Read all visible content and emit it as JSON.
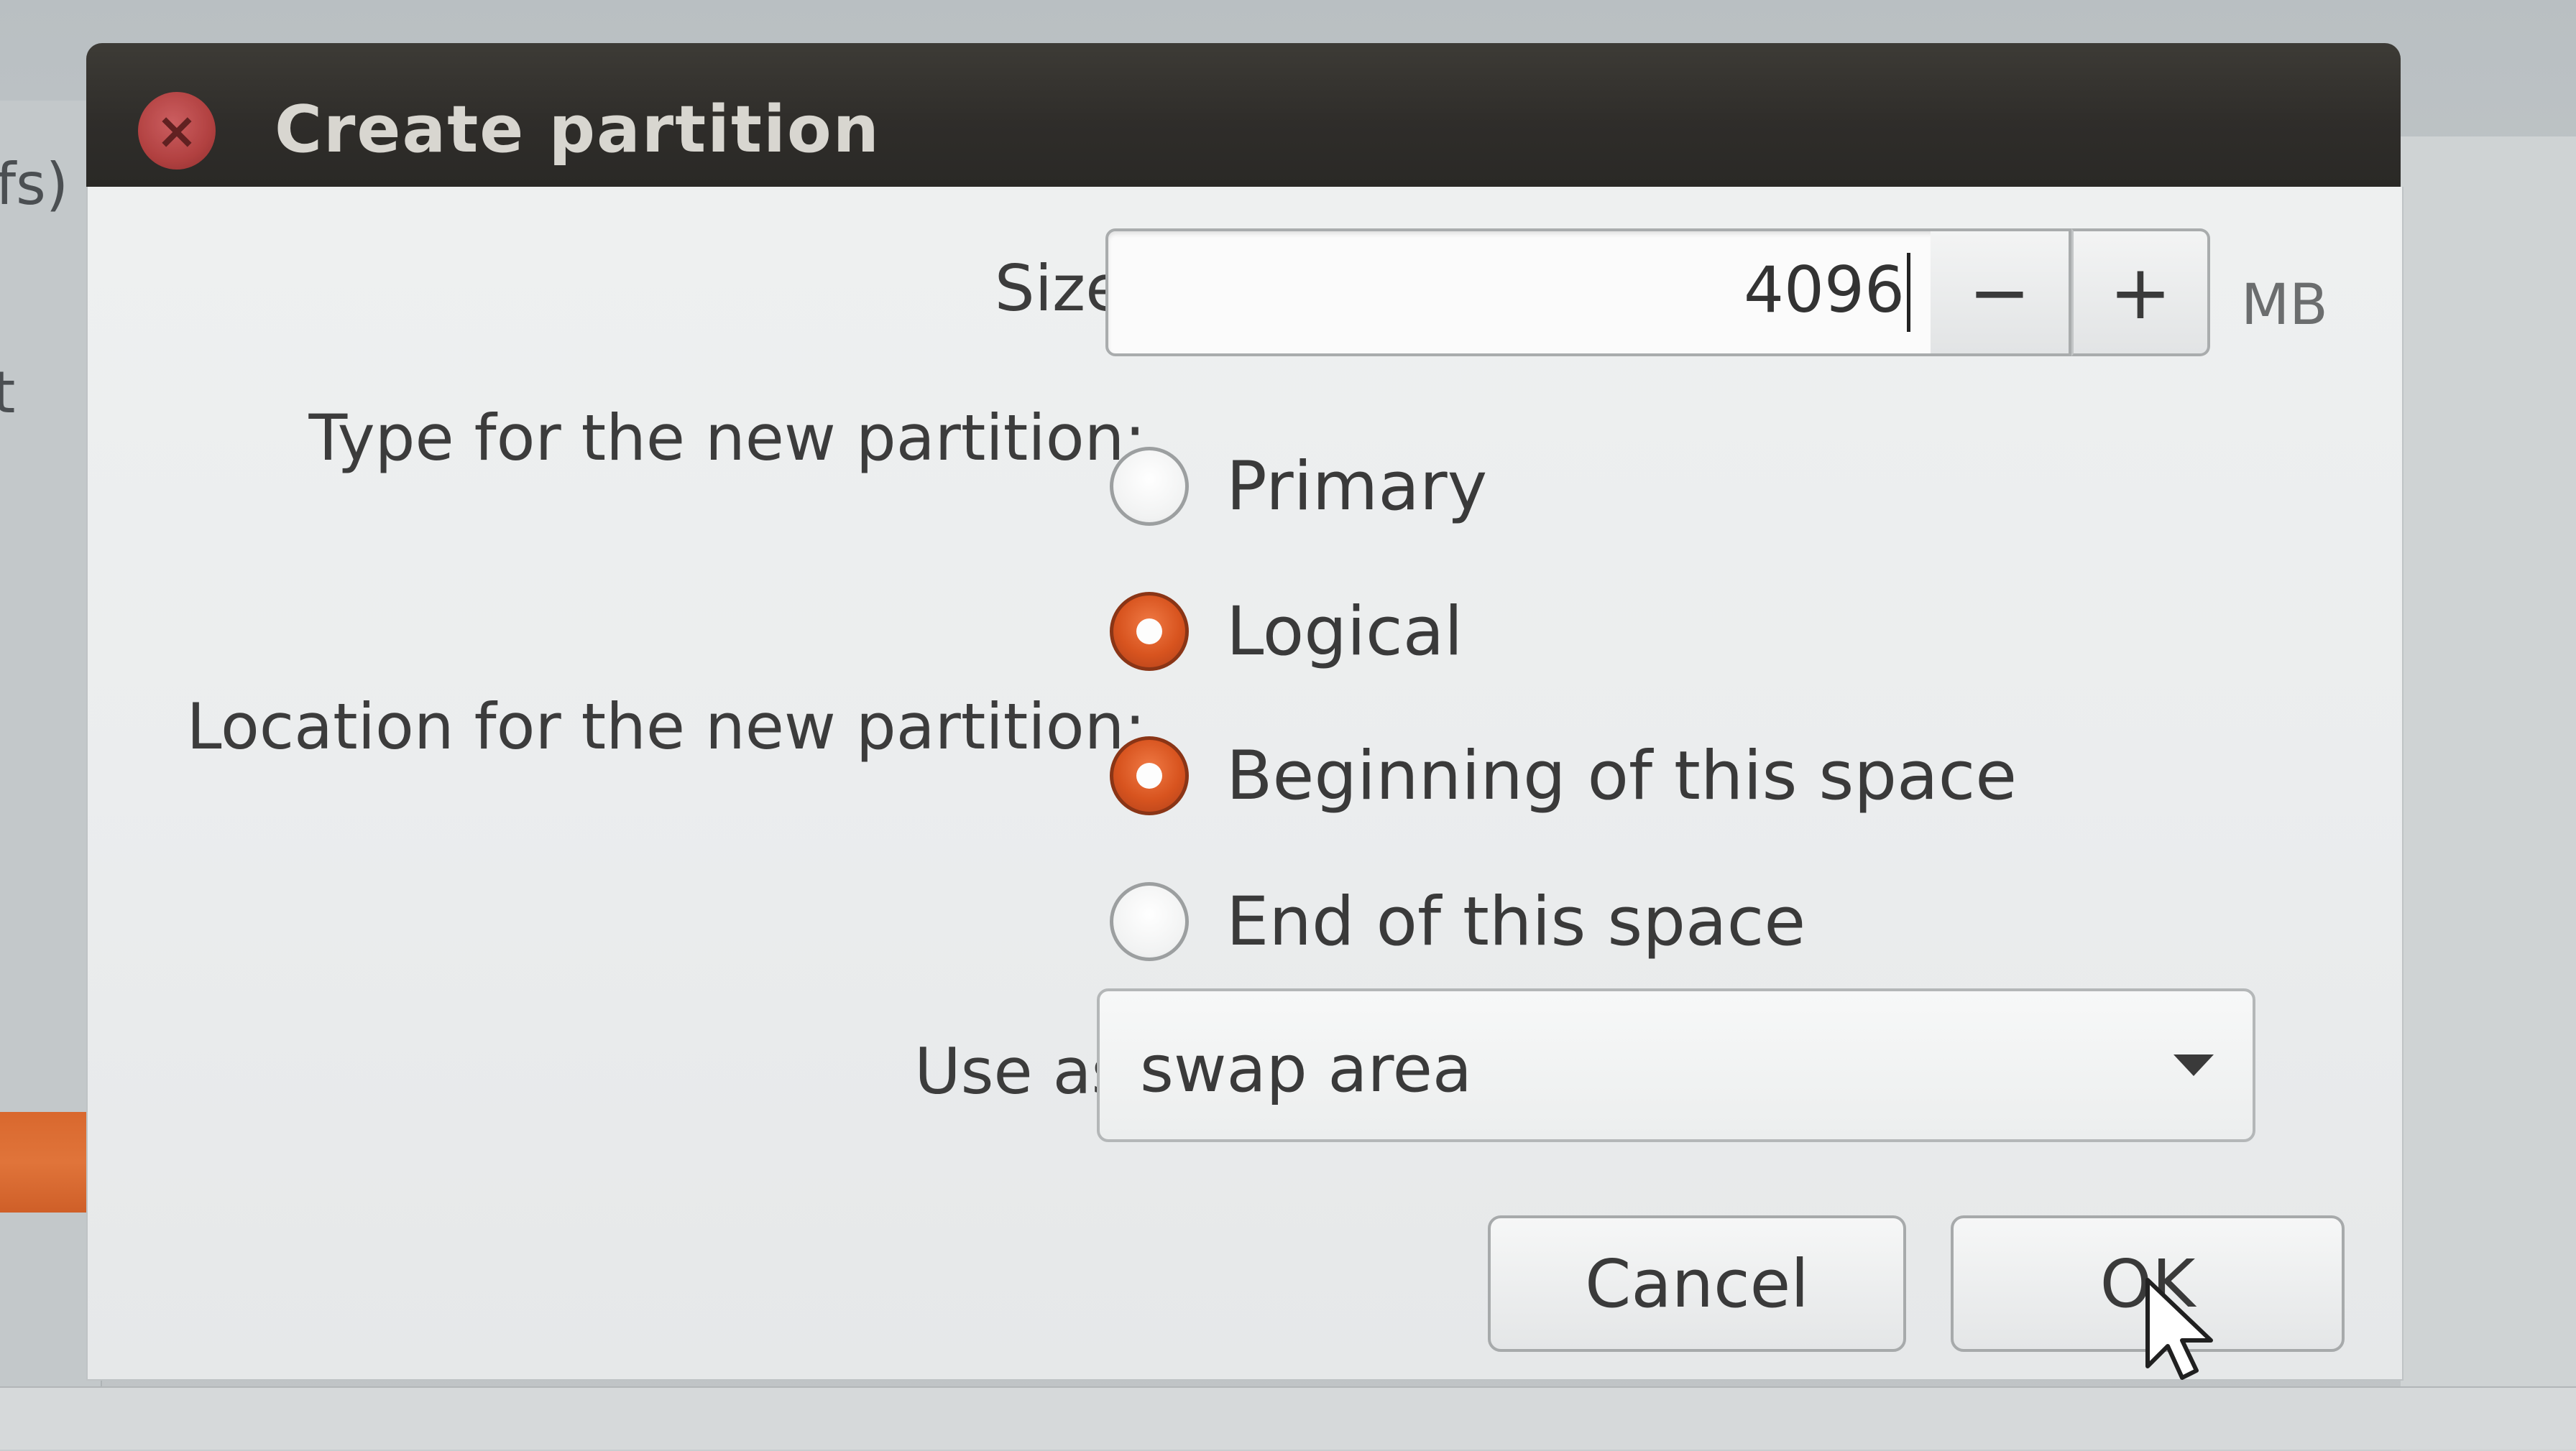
{
  "background": {
    "left_text_1": "fs)",
    "left_text_2": "t"
  },
  "dialog": {
    "title": "Create partition",
    "close_icon": "close-icon"
  },
  "size": {
    "label": "Size:",
    "value": "4096",
    "decrement_label": "−",
    "increment_label": "+",
    "unit": "MB"
  },
  "type": {
    "label": "Type for the new partition:",
    "options": [
      {
        "label": "Primary",
        "checked": false
      },
      {
        "label": "Logical",
        "checked": true
      }
    ]
  },
  "location": {
    "label": "Location for the new partition:",
    "options": [
      {
        "label": "Beginning of this space",
        "checked": true
      },
      {
        "label": "End of this space",
        "checked": false
      }
    ]
  },
  "use_as": {
    "label": "Use as:",
    "selected": "swap area"
  },
  "buttons": {
    "cancel": "Cancel",
    "ok": "OK"
  },
  "colors": {
    "accent": "#d8541f",
    "titlebar": "#2f2d2a",
    "dialog_bg": "#eceeef"
  }
}
